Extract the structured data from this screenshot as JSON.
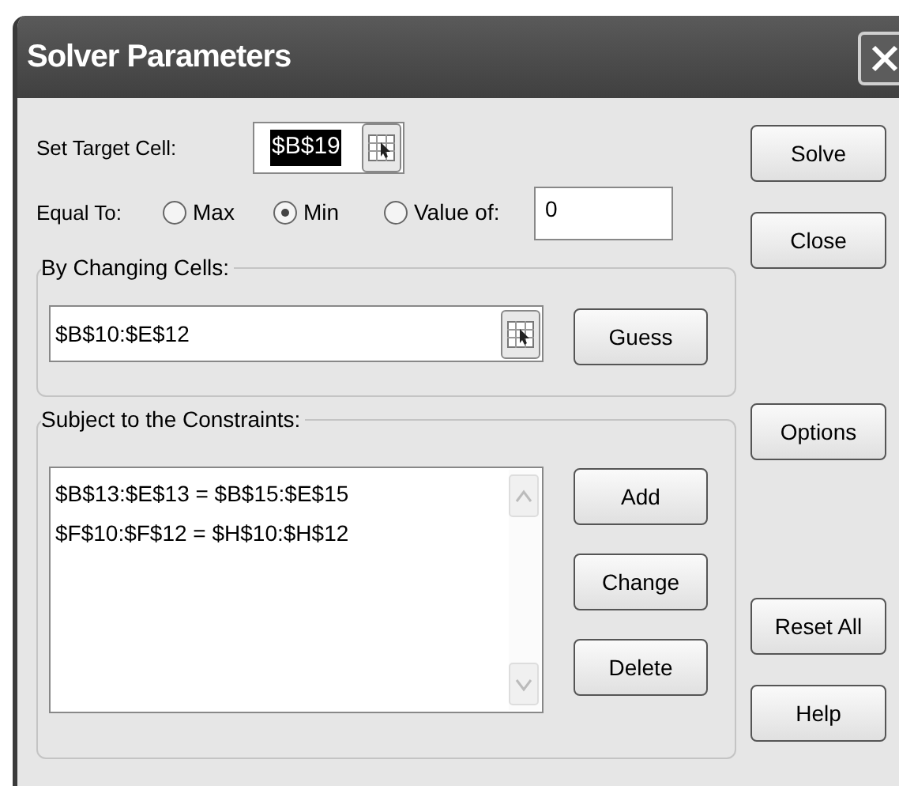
{
  "window": {
    "title": "Solver Parameters"
  },
  "target_cell": {
    "label": "Set Target Cell:",
    "value": "$B$19",
    "selected": true
  },
  "equal_to": {
    "label": "Equal To:",
    "options": [
      {
        "label": "Max",
        "selected": false
      },
      {
        "label": "Min",
        "selected": true
      },
      {
        "label": "Value of:",
        "selected": false
      }
    ],
    "value": "0"
  },
  "changing_cells": {
    "label": "By Changing Cells:",
    "value": "$B$10:$E$12",
    "button": "Guess"
  },
  "constraints": {
    "label": "Subject to the Constraints:",
    "items": [
      "$B$13:$E$13 = $B$15:$E$15",
      "$F$10:$F$12 = $H$10:$H$12"
    ],
    "buttons": [
      "Add",
      "Change",
      "Delete"
    ]
  },
  "side_buttons": [
    "Solve",
    "Close",
    "Options",
    "Reset All",
    "Help"
  ]
}
